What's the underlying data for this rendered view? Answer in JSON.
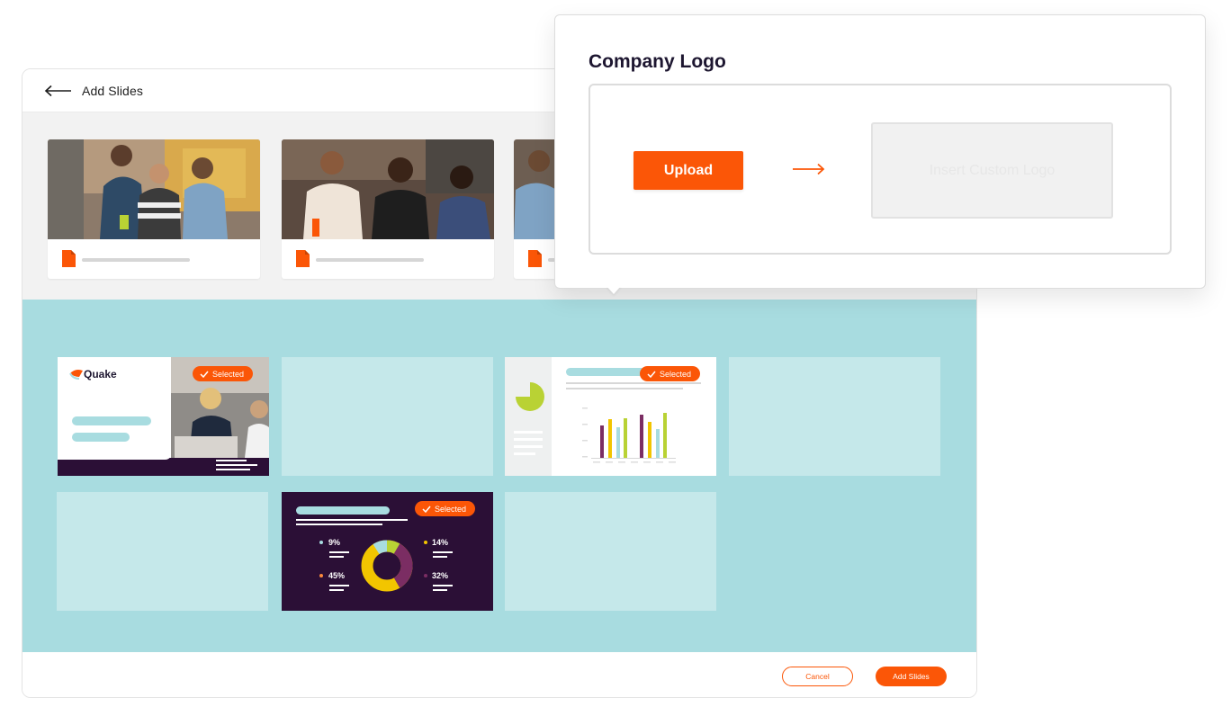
{
  "header": {
    "title": "Add Slides"
  },
  "library": {
    "cards": [
      {
        "file_type": "document"
      },
      {
        "file_type": "document"
      },
      {
        "file_type": "document"
      }
    ]
  },
  "slides": {
    "selected_label": "Selected",
    "quake": {
      "brand": "Quake"
    },
    "donut": {
      "values": [
        {
          "label": "9%",
          "color": "#a8dce0"
        },
        {
          "label": "14%",
          "color": "#f2c500"
        },
        {
          "label": "45%",
          "color": "#fb8a3c"
        },
        {
          "label": "32%",
          "color": "#7b2d63"
        }
      ]
    }
  },
  "footer": {
    "cancel_label": "Cancel",
    "add_label": "Add Slides"
  },
  "popover": {
    "title": "Company Logo",
    "upload_label": "Upload",
    "placeholder": "Insert Custom Logo"
  },
  "colors": {
    "accent": "#fb5607",
    "teal": "#a8dce0",
    "plum": "#2b0f36",
    "lime": "#b9d234"
  }
}
